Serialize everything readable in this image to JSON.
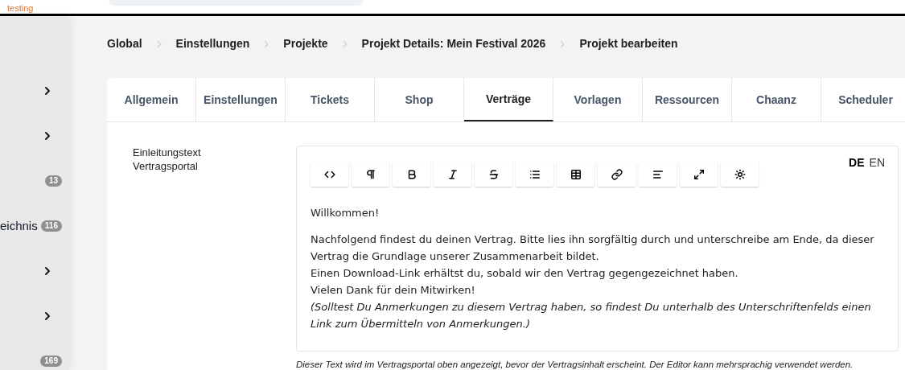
{
  "env_label": "testing",
  "sidebar": {
    "items": [
      {
        "kind": "chevron"
      },
      {
        "kind": "chevron"
      },
      {
        "kind": "badge",
        "count": "13"
      },
      {
        "kind": "badge",
        "label": "eichnis",
        "count": "116"
      },
      {
        "kind": "chevron"
      },
      {
        "kind": "chevron"
      },
      {
        "kind": "badge",
        "count": "169"
      }
    ]
  },
  "breadcrumbs": [
    "Global",
    "Einstellungen",
    "Projekte",
    "Projekt Details: Mein Festival 2026",
    "Projekt bearbeiten"
  ],
  "tabs": [
    {
      "label": "Allgemein",
      "selected": false
    },
    {
      "label": "Einstellungen",
      "selected": false
    },
    {
      "label": "Tickets",
      "selected": false
    },
    {
      "label": "Shop",
      "selected": false
    },
    {
      "label": "Verträge",
      "selected": true
    },
    {
      "label": "Vorlagen",
      "selected": false
    },
    {
      "label": "Ressourcen",
      "selected": false
    },
    {
      "label": "Chaanz",
      "selected": false
    },
    {
      "label": "Scheduler",
      "selected": false
    }
  ],
  "field": {
    "label": "Einleitungstext Vertragsportal",
    "languages": [
      {
        "code": "DE",
        "selected": true
      },
      {
        "code": "EN",
        "selected": false
      }
    ],
    "toolbar": [
      {
        "kind": "code"
      },
      {
        "kind": "paragraph"
      },
      {
        "kind": "bold"
      },
      {
        "kind": "italic"
      },
      {
        "kind": "strike"
      },
      {
        "kind": "list"
      },
      {
        "kind": "table"
      },
      {
        "kind": "link"
      },
      {
        "kind": "align"
      },
      {
        "kind": "fullscreen"
      },
      {
        "kind": "settings"
      }
    ],
    "paragraphs": [
      [
        {
          "text": "Willkommen!",
          "italic": false
        }
      ],
      [
        {
          "text": "Nachfolgend findest du deinen Vertrag. Bitte lies ihn sorgfältig durch und unterschreibe am Ende, da dieser Vertrag die Grundlage unserer Zusammenarbeit bildet.",
          "italic": false
        },
        {
          "text": "Einen Download-Link erhältst du, sobald wir den Vertrag gegengezeichnet haben.",
          "italic": false
        },
        {
          "text": "Vielen Dank für dein Mitwirken!",
          "italic": false
        },
        {
          "text": "(Solltest Du Anmerkungen zu diesem Vertrag haben, so findest Du unterhalb des Unterschriftenfelds einen Link zum Übermitteln von Anmerkungen.)",
          "italic": true
        }
      ]
    ],
    "hint": "Dieser Text wird im Vertragsportal oben angezeigt, bevor der Vertragsinhalt erscheint. Der Editor kann mehrsprachig verwendet werden."
  }
}
